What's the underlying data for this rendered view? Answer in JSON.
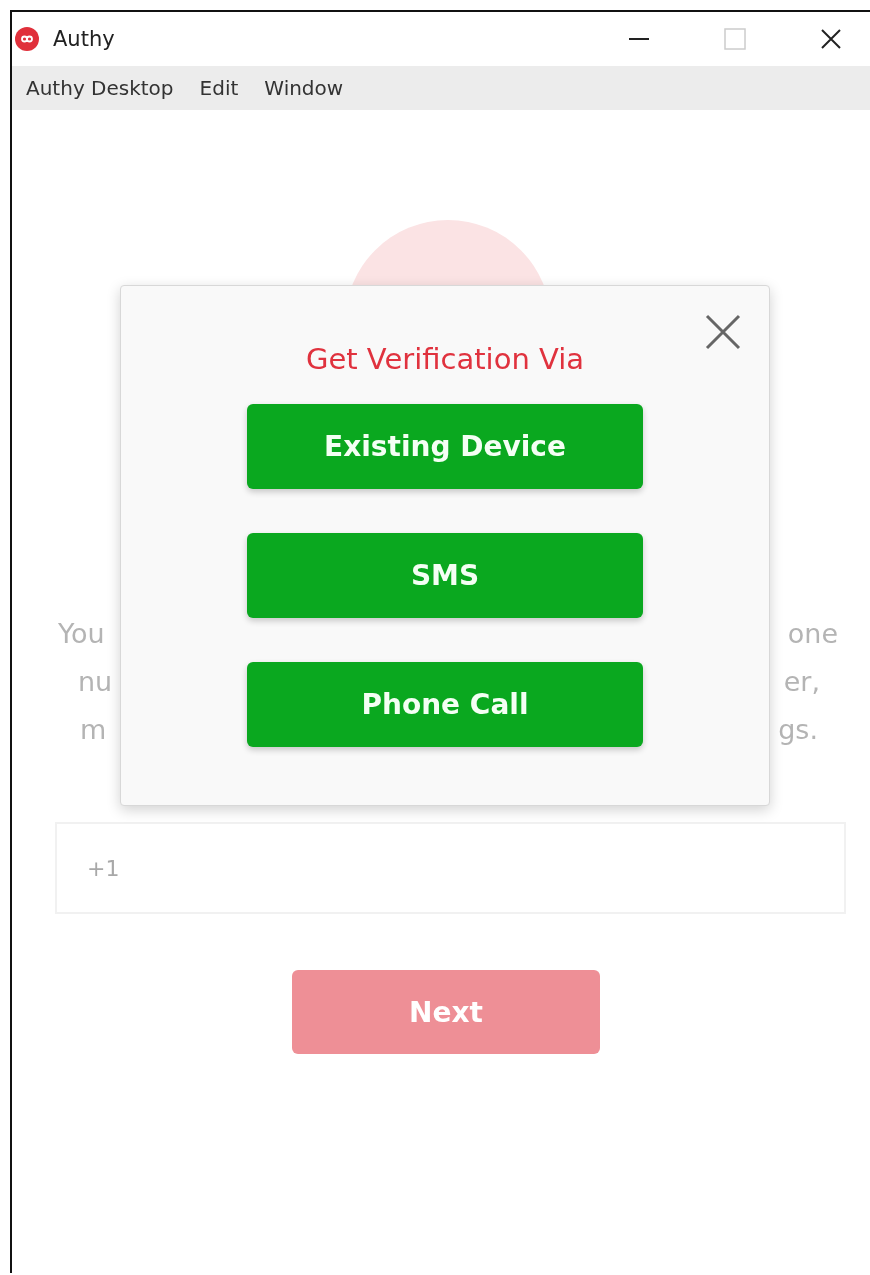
{
  "window": {
    "title": "Authy"
  },
  "menu": [
    "Authy Desktop",
    "Edit",
    "Window"
  ],
  "background": {
    "text_left": [
      "You",
      "nu",
      "m"
    ],
    "text_right": [
      "one",
      "er,",
      "gs."
    ],
    "country_code": "+1",
    "next_button": "Next"
  },
  "dialog": {
    "title": "Get Verification Via",
    "options": [
      "Existing Device",
      "SMS",
      "Phone Call"
    ]
  }
}
